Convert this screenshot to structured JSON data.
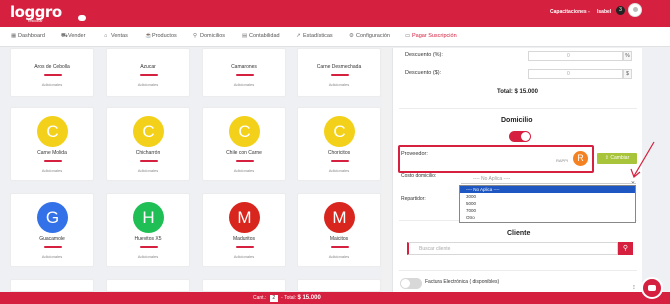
{
  "header": {
    "logo_text": "loggro",
    "logo_sub": "restobar",
    "company": "Capacitaciones -",
    "user": "Isabel",
    "user_badge": "3"
  },
  "nav": {
    "items": [
      {
        "icon": "dashboard-icon",
        "glyph": "▦",
        "label": "Dashboard"
      },
      {
        "icon": "cart-icon",
        "glyph": "⛟",
        "label": "Vender"
      },
      {
        "icon": "tag-icon",
        "glyph": "⌂",
        "label": "Ventas"
      },
      {
        "icon": "products-icon",
        "glyph": "☕",
        "label": "Productos"
      },
      {
        "icon": "delivery-icon",
        "glyph": "⚲",
        "label": "Domicilios"
      },
      {
        "icon": "accounting-icon",
        "glyph": "▤",
        "label": "Contabilidad"
      },
      {
        "icon": "chart-icon",
        "glyph": "↗",
        "label": "Estadísticas"
      },
      {
        "icon": "gear-icon",
        "glyph": "⚙",
        "label": "Configuración"
      },
      {
        "icon": "payment-icon",
        "glyph": "▭",
        "label": "Pagar Suscripción"
      }
    ]
  },
  "products": [
    {
      "name": "Aros de Cebolla",
      "letter": "",
      "color": "",
      "addl": "Adicionales"
    },
    {
      "name": "Azucar",
      "letter": "",
      "color": "",
      "addl": "Adicionales"
    },
    {
      "name": "Camarones",
      "letter": "",
      "color": "",
      "addl": "Adicionales"
    },
    {
      "name": "Carne Desmechada",
      "letter": "",
      "color": "",
      "addl": "Adicionales"
    },
    {
      "name": "Carne Molida",
      "letter": "C",
      "color": "#f3d11a",
      "addl": "Adicionales"
    },
    {
      "name": "Chicharrón",
      "letter": "C",
      "color": "#f3d11a",
      "addl": "Adicionales"
    },
    {
      "name": "Chile con Carne",
      "letter": "C",
      "color": "#f3d11a",
      "addl": "Adicionales"
    },
    {
      "name": "Choricitos",
      "letter": "C",
      "color": "#f3d11a",
      "addl": "Adicionales"
    },
    {
      "name": "Guacamole",
      "letter": "G",
      "color": "#3371e8",
      "addl": "Adicionales"
    },
    {
      "name": "Huevitos X5",
      "letter": "H",
      "color": "#1fbf55",
      "addl": "Adicionales"
    },
    {
      "name": "Maduritos",
      "letter": "M",
      "color": "#d8261f",
      "addl": "Adicionales"
    },
    {
      "name": "Maicitos",
      "letter": "M",
      "color": "#d8261f",
      "addl": "Adicionales"
    }
  ],
  "panel": {
    "discount_pct_label": "Descuento (%):",
    "discount_pct_value": "0",
    "discount_pct_unit": "%",
    "discount_amt_label": "Descuento ($):",
    "discount_amt_value": "0",
    "discount_amt_unit": "$",
    "total": "Total: $ 15.000",
    "domicilio_title": "Domicilio",
    "domicilio_enabled": true,
    "proveedor_label": "Proveedor:",
    "proveedor_name": "RAPPI",
    "proveedor_letter": "R",
    "cambiar_label": "Cambiar",
    "costo_label": "Costo domicilio:",
    "costo_value": "---- No Aplica ----",
    "repartidor_label": "Repartidor:",
    "dropdown_options": [
      "---- No Aplica ----",
      "3000",
      "5000",
      "7000",
      "Otro"
    ],
    "dropdown_selected": 0,
    "cliente_title": "Cliente",
    "cliente_placeholder": "Buscar cliente",
    "factura_label": "Factura Electrónica ( disponibles)",
    "factura_enabled": false
  },
  "bottom": {
    "cant_label": "Cant.:",
    "qty": "2",
    "total_label": "- Total:",
    "total_value": "$ 15.000"
  },
  "colors": {
    "brand": "#d5203f",
    "accent_green": "#a8c43a",
    "provider_orange": "#f58220",
    "select_blue": "#1e56c2"
  }
}
